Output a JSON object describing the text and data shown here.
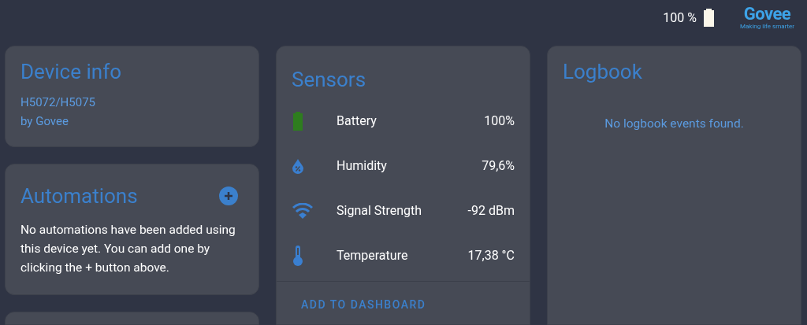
{
  "header": {
    "battery_text": "100 %",
    "logo": {
      "name": "Govee",
      "tagline": "Making life smarter"
    }
  },
  "device_info": {
    "title": "Device info",
    "model": "H5072/H5075",
    "manufacturer": "by Govee"
  },
  "automations": {
    "title": "Automations",
    "text": "No automations have been added using this device yet. You can add one by clicking the + button above."
  },
  "sensors": {
    "title": "Sensors",
    "items": [
      {
        "kind": "battery",
        "name": "Battery",
        "value": "100%"
      },
      {
        "kind": "humidity",
        "name": "Humidity",
        "value": "79,6%"
      },
      {
        "kind": "signal",
        "name": "Signal Strength",
        "value": "-92 dBm"
      },
      {
        "kind": "temperature",
        "name": "Temperature",
        "value": "17,38 °C"
      }
    ],
    "action": "ADD TO DASHBOARD"
  },
  "logbook": {
    "title": "Logbook",
    "empty_text": "No logbook events found."
  }
}
